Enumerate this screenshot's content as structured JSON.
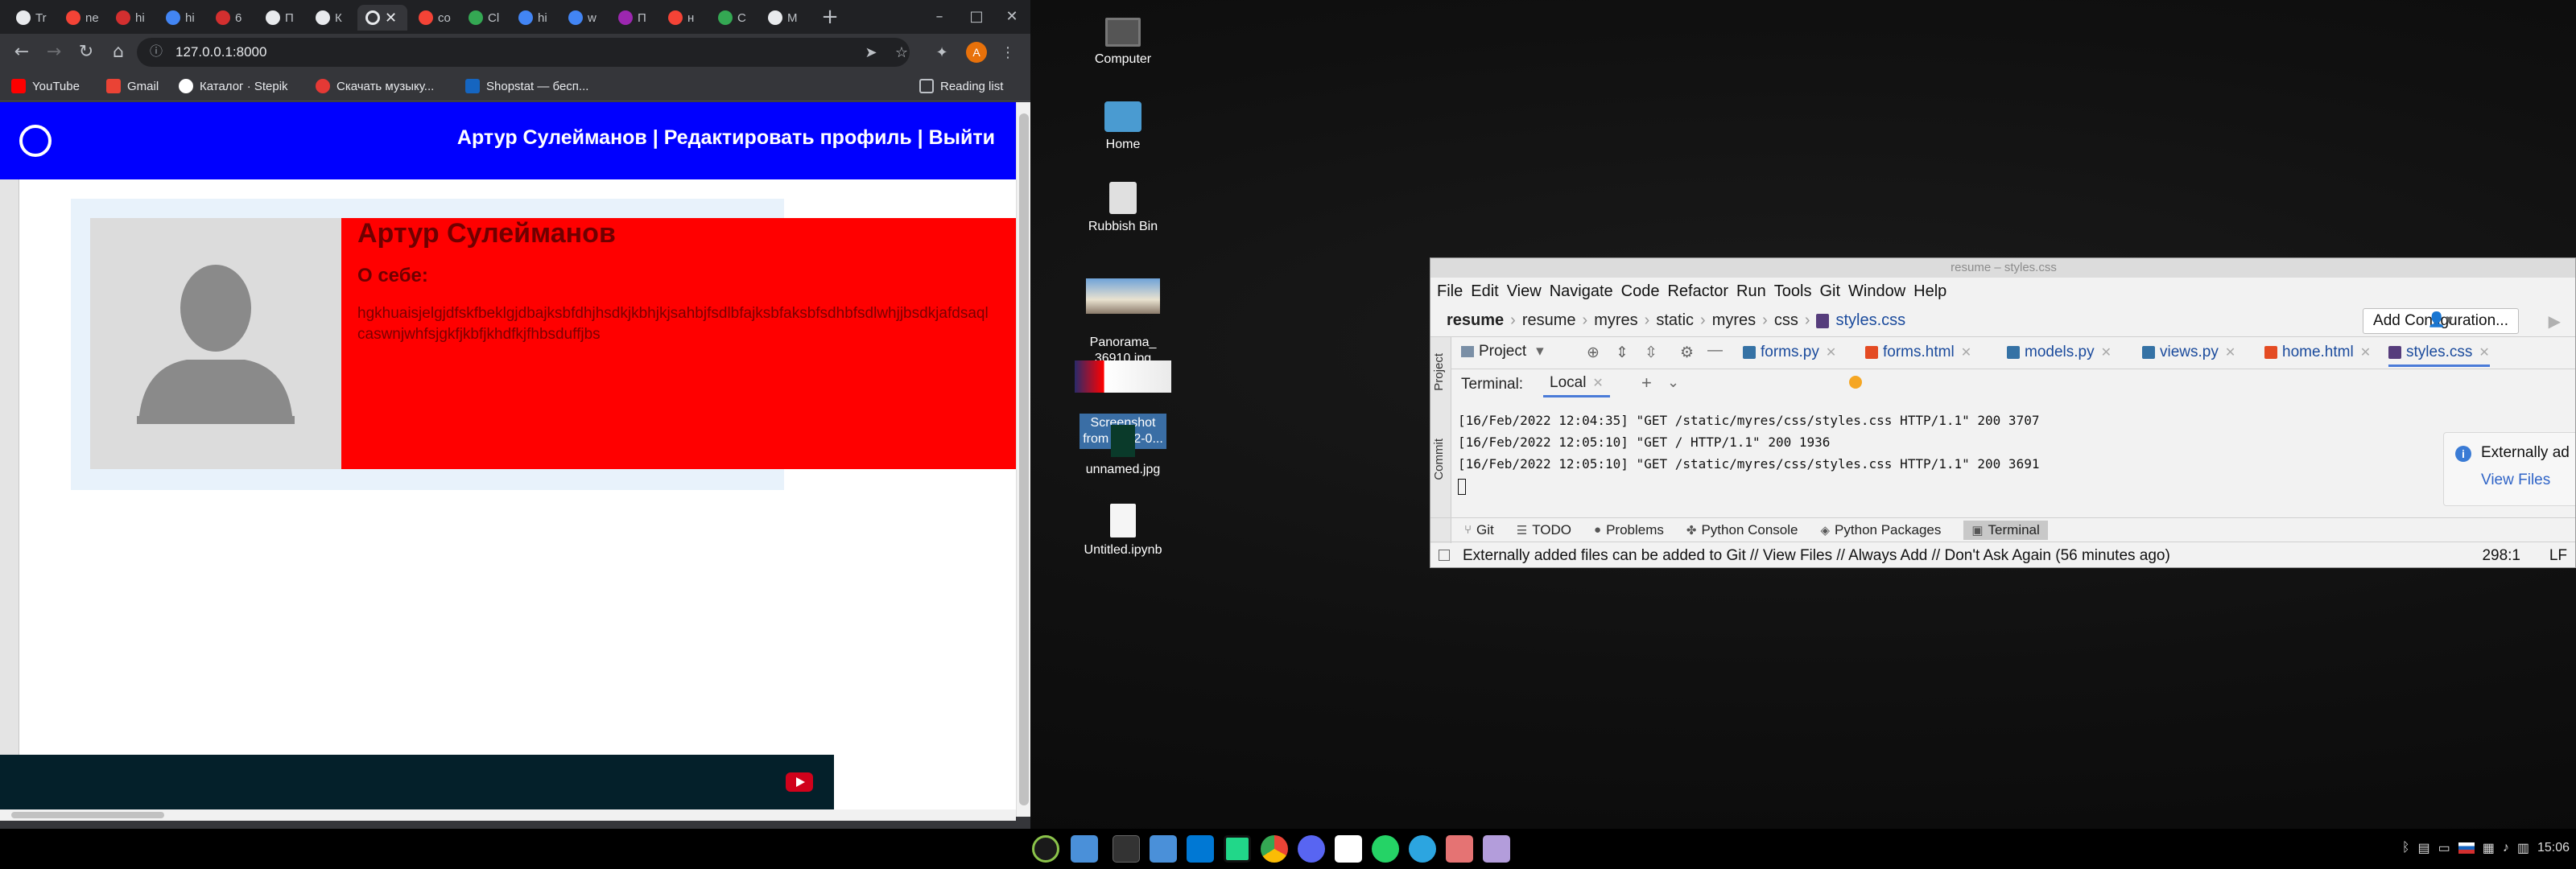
{
  "browser": {
    "tabs": [
      {
        "label": "Tr",
        "color": "#e8eaed"
      },
      {
        "label": "ne",
        "color": "#f44336"
      },
      {
        "label": "hi",
        "color": "#d32f2f"
      },
      {
        "label": "hi",
        "color": "#4285f4"
      },
      {
        "label": "6",
        "color": "#d32f2f"
      },
      {
        "label": "П",
        "color": "#e8eaed"
      },
      {
        "label": "К",
        "color": "#e8eaed"
      },
      {
        "label": "",
        "color": "#e8eaed"
      },
      {
        "label": "co",
        "color": "#f44336"
      },
      {
        "label": "Cl",
        "color": "#34a853"
      },
      {
        "label": "hi",
        "color": "#4285f4"
      },
      {
        "label": "w",
        "color": "#4285f4"
      },
      {
        "label": "П",
        "color": "#9c27b0"
      },
      {
        "label": "н",
        "color": "#f44336"
      },
      {
        "label": "C",
        "color": "#34a853"
      },
      {
        "label": "M",
        "color": "#e8eaed"
      }
    ],
    "url": "127.0.0.1:8000",
    "bookmarks": [
      {
        "label": "YouTube",
        "color": "#ff0000"
      },
      {
        "label": "Gmail",
        "color": "#ea4335"
      },
      {
        "label": "Каталог · Stepik",
        "color": "#ffffff"
      },
      {
        "label": "Скачать музыку...",
        "color": "#e53935"
      },
      {
        "label": "Shopstat — бесп...",
        "color": "#1565c0"
      }
    ],
    "reading_list": "Reading list",
    "avatar_letter": "A"
  },
  "site": {
    "nav": "Артур Сулейманов | Редактировать профиль | Выйти",
    "name": "Артур Сулейманов",
    "about_heading": "О себе:",
    "about_text": "hgkhuaisjelgjdfskfbeklgjdbajksbfdhjhsdkjkbhjkjsahbjfsdlbfajksbfaksbfsdhbfsdlwhjjbsdkjafdsaqlcaswnjwhfsjgkfjkbfjkhdfkjfhbsduffjbs"
  },
  "desktop_icons": [
    {
      "label": "Computer"
    },
    {
      "label": "Home"
    },
    {
      "label": "Rubbish Bin"
    },
    {
      "label": "Panorama_\n36910.jpg"
    },
    {
      "label": "Screenshot\nfrom 2022-0..."
    },
    {
      "label": "unnamed.jpg"
    },
    {
      "label": "Untitled.ipynb"
    }
  ],
  "pycharm": {
    "title": "resume – styles.css",
    "menu": [
      "File",
      "Edit",
      "View",
      "Navigate",
      "Code",
      "Refactor",
      "Run",
      "Tools",
      "Git",
      "Window",
      "Help"
    ],
    "crumbs": [
      "resume",
      "resume",
      "myres",
      "static",
      "myres",
      "css",
      "styles.css"
    ],
    "add_config": "Add Configuration...",
    "side_tabs": [
      "Project",
      "Commit"
    ],
    "project_label": "Project",
    "file_tabs": [
      {
        "label": "forms.py",
        "color": "#3572a5"
      },
      {
        "label": "forms.html",
        "color": "#e44b23"
      },
      {
        "label": "models.py",
        "color": "#3572a5"
      },
      {
        "label": "views.py",
        "color": "#3572a5"
      },
      {
        "label": "home.html",
        "color": "#e44b23"
      },
      {
        "label": "styles.css",
        "color": "#563d7c"
      }
    ],
    "terminal_label": "Terminal:",
    "terminal_tab": "Local",
    "log": [
      "[16/Feb/2022 12:04:35] \"GET /static/myres/css/styles.css HTTP/1.1\" 200 3707",
      "[16/Feb/2022 12:05:10] \"GET / HTTP/1.1\" 200 1936",
      "[16/Feb/2022 12:05:10] \"GET /static/myres/css/styles.css HTTP/1.1\" 200 3691"
    ],
    "notification_title": "Externally ad",
    "notification_link": "View Files",
    "bottom_tabs": [
      "Git",
      "TODO",
      "Problems",
      "Python Console",
      "Python Packages",
      "Terminal"
    ],
    "status": "Externally added files can be added to Git // View Files // Always Add // Don't Ask Again (56 minutes ago)",
    "position": "298:1",
    "line_sep": "LF"
  },
  "taskbar": {
    "clock": "15:06",
    "apps": [
      "#8bc34a",
      "#4a90d9",
      "#333333",
      "#4a90d9",
      "#0078d4",
      "#21d789",
      "#4285f4",
      "#5865f2",
      "#ffffff",
      "#25d366",
      "#2ca5e0",
      "#e57373",
      "#b39ddb"
    ]
  }
}
